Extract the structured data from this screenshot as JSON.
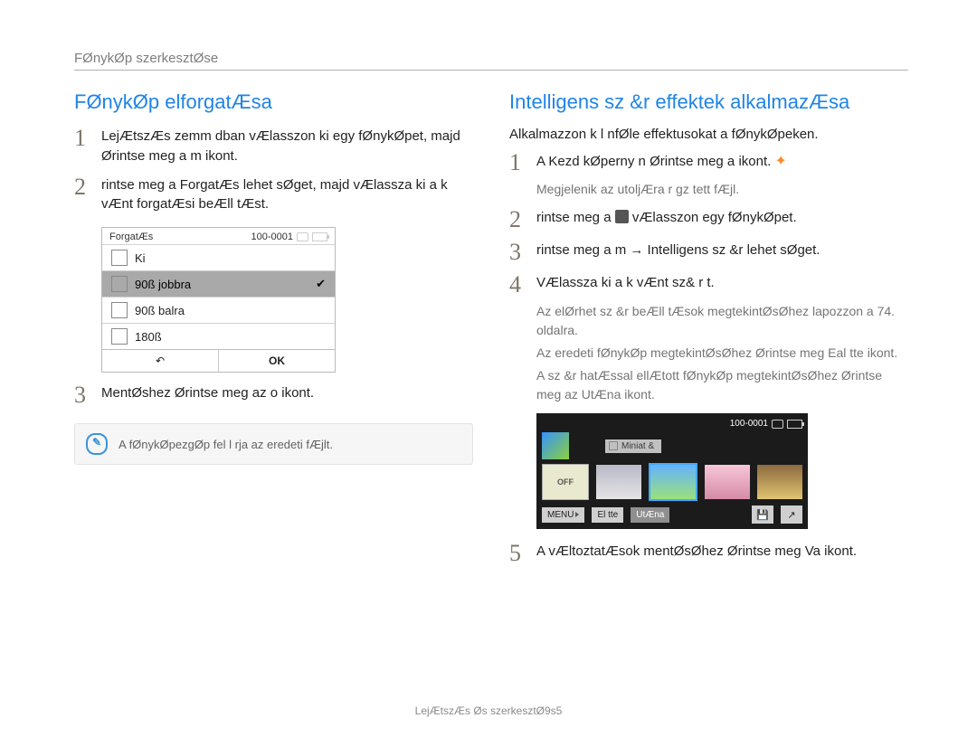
{
  "chapter_title": "FØnykØp szerkesztØse",
  "left": {
    "heading": "FØnykØp elforgatÆsa",
    "step1": "LejÆtszÆs  zemm dban vÆlasszon ki egy fØnykØpet, majd Ørintse meg a m  ikont.",
    "step2": " rintse meg a  ForgatÆs lehet sØget, majd vÆlassza ki a k vÆnt forgatÆsi beÆll tÆst.",
    "step3": "MentØshez Ørintse meg az o  ikont.",
    "note": "A fØnykØpezgØp fel l rja az eredeti fÆjlt."
  },
  "rotate_screen": {
    "title": "ForgatÆs",
    "counter": "100-0001",
    "options": {
      "off": "Ki",
      "r90": "90ß jobbra",
      "l90": "90ß balra",
      "r180": "180ß"
    },
    "back_symbol": "↶",
    "ok": "OK"
  },
  "right": {
    "heading": "Intelligens sz &r  effektek alkalmazÆsa",
    "intro": "Alkalmazzon k l nfØle effektusokat a fØnykØpeken.",
    "step1": "A Kezd kØperny n Ørintse meg a     ikont.",
    "step1_sub": "Megjelenik az utoljÆra r gz tett fÆjl.",
    "step2_a": " rintse meg a   ",
    "step2_b": "  vÆlasszon egy fØnykØpet.",
    "step3": " rintse meg a  m  →  Intelligens sz &r  lehet sØget.",
    "step4": "VÆlassza ki a k vÆnt sz& r t.",
    "step4_sub1": "Az elØrhet  sz &r  beÆll tÆsok megtekintØsØhez lapozzon a 74. oldalra.",
    "step4_sub2": "Az eredeti fØnykØp megtekintØsØhez Ørintse meg Eal  tte ikont.",
    "step4_sub3": "A sz &r  hatÆssal ellÆtott fØnykØp megtekintØsØhez Ørintse meg az UtÆna ikont.",
    "step5": "A vÆltoztatÆsok mentØsØhez Ørintse meg  Va ikont."
  },
  "filter_screen": {
    "counter": "100-0001",
    "tag": "Miniat &",
    "off": "OFF",
    "menu": "MENU",
    "before": "El  tte",
    "after": "UtÆna"
  },
  "footer": "LejÆtszÆs Øs szerkesztØ9s5"
}
